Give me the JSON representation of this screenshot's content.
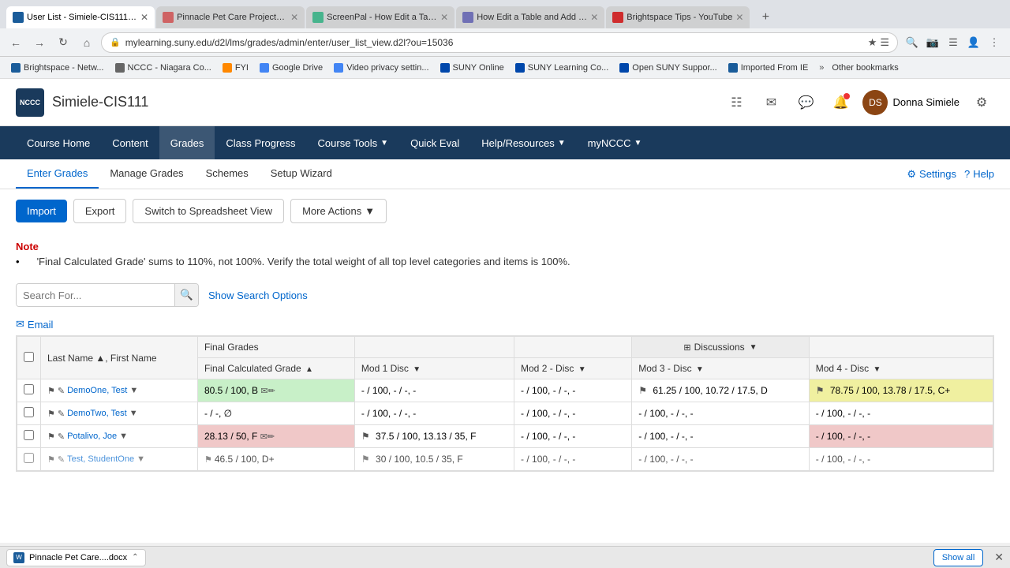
{
  "browser": {
    "tabs": [
      {
        "label": "User List - Simiele-CIS111 -...",
        "active": true,
        "favicon": "U"
      },
      {
        "label": "Pinnacle Pet Care Project 1 ...",
        "active": false,
        "favicon": "P"
      },
      {
        "label": "ScreenPal - How Edit a Tab...",
        "active": false,
        "favicon": "S"
      },
      {
        "label": "How Edit a Table and Add P...",
        "active": false,
        "favicon": "H"
      },
      {
        "label": "Brightspace Tips - YouTube",
        "active": false,
        "favicon": "Y"
      }
    ],
    "url": "mylearning.suny.edu/d2l/lms/grades/admin/enter/user_list_view.d2l?ou=15036",
    "bookmarks": [
      {
        "label": "Brightspace - Netw..."
      },
      {
        "label": "NCCC - Niagara Co..."
      },
      {
        "label": "FYI"
      },
      {
        "label": "Google Drive"
      },
      {
        "label": "Video privacy settin..."
      },
      {
        "label": "SUNY Online"
      },
      {
        "label": "SUNY Learning Co..."
      },
      {
        "label": "Open SUNY Suppor..."
      },
      {
        "label": "Imported From IE"
      },
      {
        "label": "Other bookmarks"
      }
    ]
  },
  "header": {
    "course_name": "Simiele-CIS111",
    "logo_text": "NCCC",
    "user_name": "Donna Simiele",
    "avatar_initials": "DS"
  },
  "nav": {
    "items": [
      {
        "label": "Course Home",
        "has_dropdown": false
      },
      {
        "label": "Content",
        "has_dropdown": false
      },
      {
        "label": "Grades",
        "has_dropdown": false
      },
      {
        "label": "Class Progress",
        "has_dropdown": false
      },
      {
        "label": "Course Tools",
        "has_dropdown": true
      },
      {
        "label": "Quick Eval",
        "has_dropdown": false
      },
      {
        "label": "Help/Resources",
        "has_dropdown": true
      },
      {
        "label": "myNCCC",
        "has_dropdown": true
      }
    ]
  },
  "sub_nav": {
    "tabs": [
      {
        "label": "Enter Grades",
        "active": true
      },
      {
        "label": "Manage Grades",
        "active": false
      },
      {
        "label": "Schemes",
        "active": false
      },
      {
        "label": "Setup Wizard",
        "active": false
      }
    ],
    "settings_label": "Settings",
    "help_label": "Help"
  },
  "toolbar": {
    "import_label": "Import",
    "export_label": "Export",
    "spreadsheet_label": "Switch to Spreadsheet View",
    "more_actions_label": "More Actions"
  },
  "note": {
    "label": "Note",
    "text": "'Final Calculated Grade' sums to 110%, not 100%. Verify the total weight of all top level categories and items is 100%."
  },
  "search": {
    "placeholder": "Search For...",
    "show_options_label": "Show Search Options"
  },
  "email_link": "Email",
  "table": {
    "col_headers": {
      "name": "Last Name ▲, First Name",
      "final_grades": "Final Grades",
      "final_calculated": "Final Calculated Grade",
      "discussions": "Discussions",
      "mod1_disc": "Mod 1 Disc",
      "mod2_disc": "Mod 2 - Disc",
      "mod3_disc": "Mod 3 - Disc",
      "mod4_disc": "Mod 4 - Disc"
    },
    "rows": [
      {
        "name": "DemoOne, Test",
        "final_grade": "80.5 / 100, B",
        "grade_class": "grade-green",
        "mod1": "- / 100, - / -, -",
        "mod2": "- / 100, - / -, -",
        "mod3": "61.25 / 100, 10.72 / 17.5, D",
        "mod4": "78.75 / 100, 13.78 / 17.5, C+"
      },
      {
        "name": "DemoTwo, Test",
        "final_grade": "- / -, ∅",
        "grade_class": "",
        "mod1": "- / 100, - / -, -",
        "mod2": "- / 100, - / -, -",
        "mod3": "- / 100, - / -, -",
        "mod4": "- / 100, - / -, -"
      },
      {
        "name": "Potalivo, Joe",
        "final_grade": "28.13 / 50, F",
        "grade_class": "grade-red",
        "mod1": "37.5 / 100, 13.13 / 35, F",
        "mod2": "- / 100, - / -, -",
        "mod3": "- / 100, - / -, -",
        "mod4": "- / 100, - / -, -"
      },
      {
        "name": "Test, StudentOne",
        "final_grade": "46.5 / 100, D+",
        "grade_class": "",
        "mod1": "30 / 100, 10.5 / 35, F",
        "mod2": "- / 100, - / -, -",
        "mod3": "- / 100, - / -, -",
        "mod4": "- / 100, - / -, -"
      }
    ]
  },
  "bottom_bar": {
    "file_name": "Pinnacle Pet Care....docx",
    "show_all_label": "Show all",
    "close_label": "✕"
  }
}
